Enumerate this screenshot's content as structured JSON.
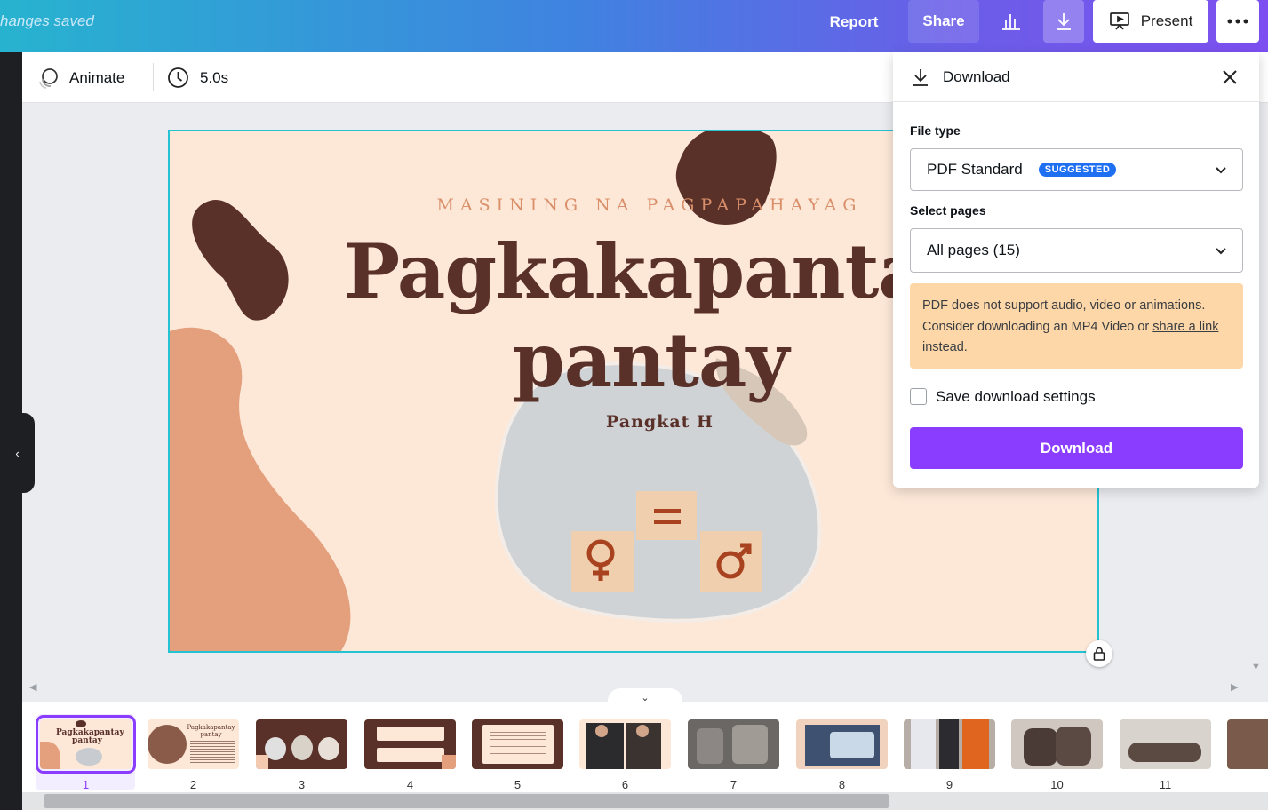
{
  "topbar": {
    "saved_text": "hanges saved",
    "report": "Report",
    "share": "Share",
    "present": "Present"
  },
  "toolbar": {
    "animate": "Animate",
    "duration": "5.0s"
  },
  "slide": {
    "subtitle": "MASINING NA PAGPAPAHAYAG",
    "title_line1": "Pagkakapantay-",
    "title_line2": "pantay",
    "author": "Pangkat H"
  },
  "download_panel": {
    "title": "Download",
    "file_type_label": "File type",
    "file_type_value": "PDF Standard",
    "suggested_badge": "SUGGESTED",
    "pages_label": "Select pages",
    "pages_value": "All pages (15)",
    "warning_prefix": "PDF does not support audio, video or animations. Consider downloading an MP4 Video or ",
    "warning_link": "share a link",
    "warning_suffix": " instead.",
    "save_settings": "Save download settings",
    "download_button": "Download"
  },
  "thumbnails": [
    {
      "num": "1",
      "thumb_text": "Pagkakapantay pantay"
    },
    {
      "num": "2",
      "thumb_text": "Pagkakapantay pantay"
    },
    {
      "num": "3"
    },
    {
      "num": "4"
    },
    {
      "num": "5"
    },
    {
      "num": "6"
    },
    {
      "num": "7"
    },
    {
      "num": "8"
    },
    {
      "num": "9"
    },
    {
      "num": "10"
    },
    {
      "num": "11"
    }
  ],
  "colors": {
    "accent": "#8b3dff",
    "slide_bg": "#fde8d8",
    "slide_brown": "#5a3129",
    "slide_salmon": "#e49f7d",
    "warning_bg": "#fdd7a7"
  }
}
